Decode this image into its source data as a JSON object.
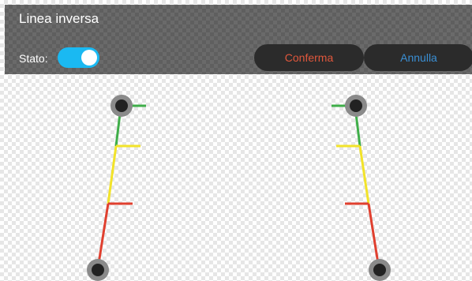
{
  "header": {
    "title": "Linea inversa",
    "stato_label": "Stato:",
    "toggle_on": true,
    "confirm_label": "Conferma",
    "cancel_label": "Annulla"
  },
  "colors": {
    "toggle": "#1ab9f2",
    "confirm_text": "#e0573c",
    "cancel_text": "#3a8fd4",
    "green": "#3fae49",
    "yellow": "#f2e32a",
    "red": "#e0402f",
    "handle_ring": "#8a8a8a",
    "handle_core": "#222222"
  }
}
